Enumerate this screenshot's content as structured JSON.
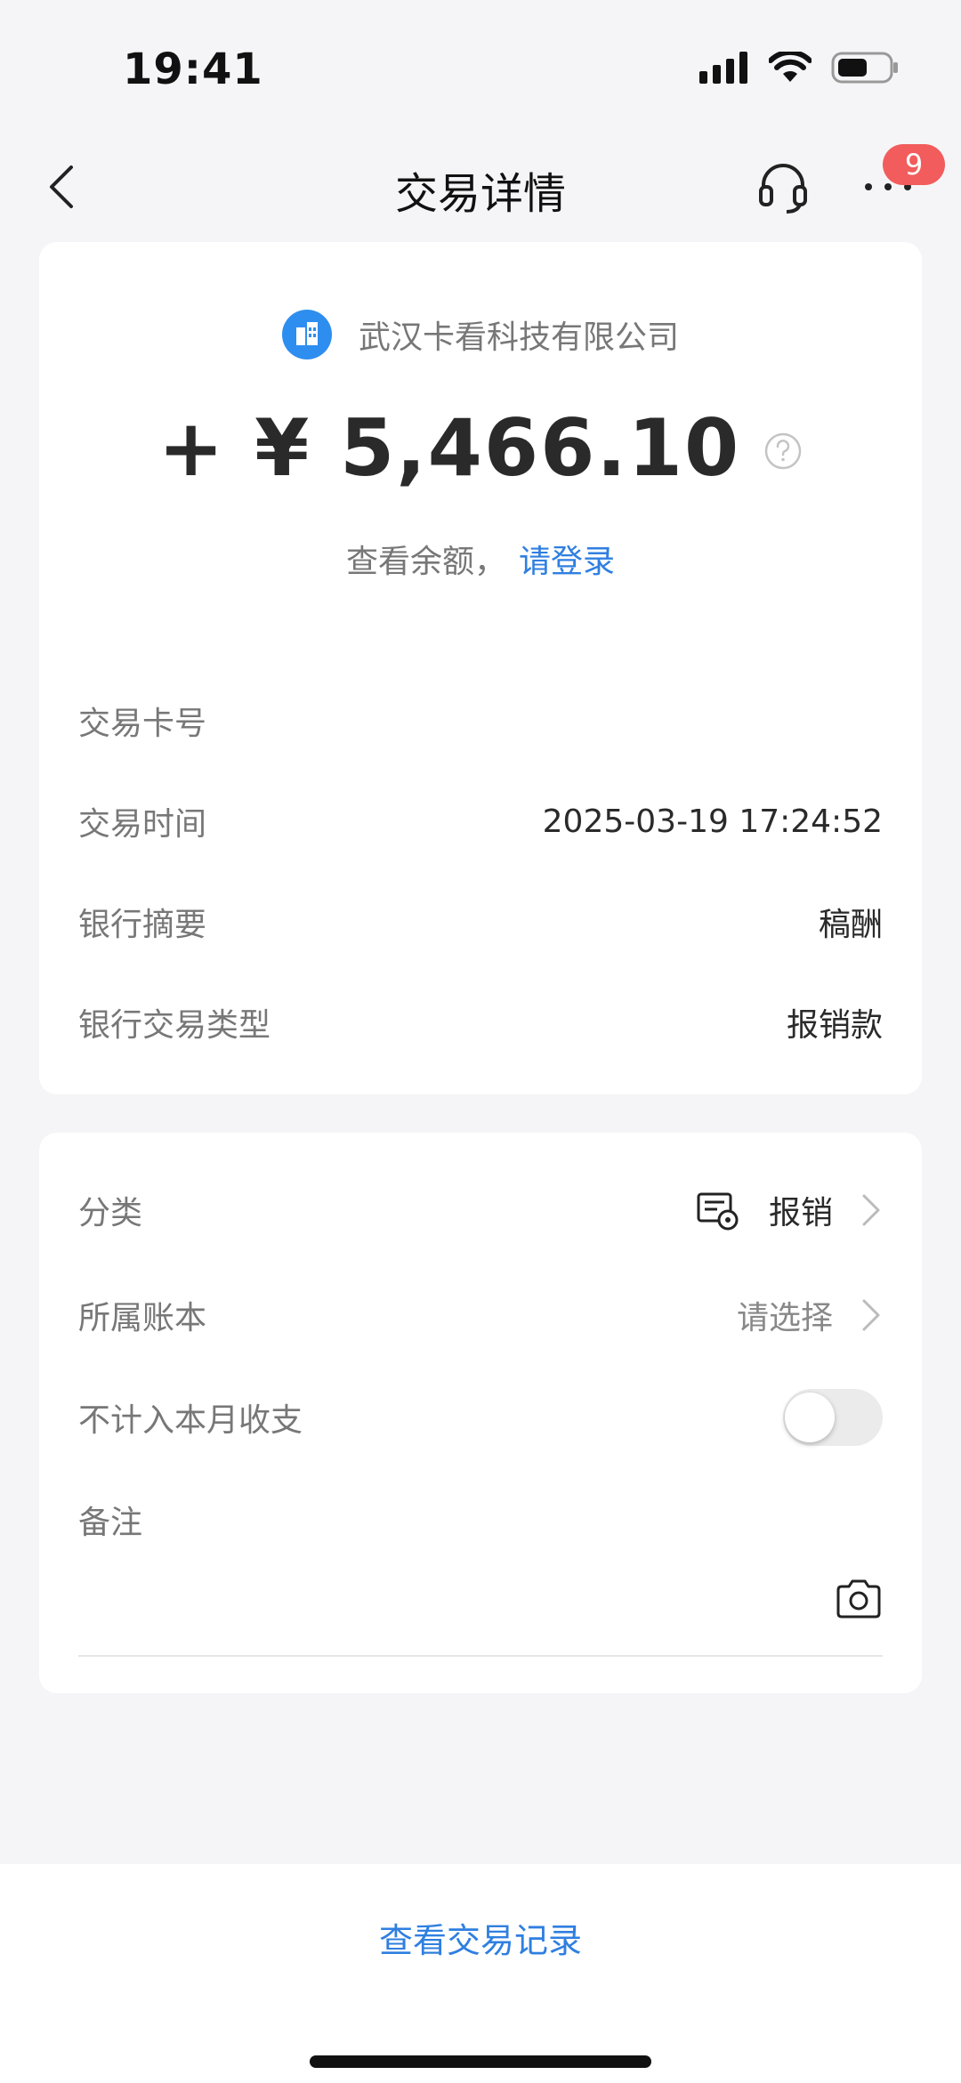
{
  "status_bar": {
    "time": "19:41"
  },
  "nav": {
    "title": "交易详情",
    "badge_count": "9"
  },
  "transaction": {
    "merchant_name": "武汉卡看科技有限公司",
    "amount": "+ ¥ 5,466.10",
    "balance_label": "查看余额，",
    "login_link": "请登录"
  },
  "details": [
    {
      "label": "交易卡号",
      "value": ""
    },
    {
      "label": "交易时间",
      "value": "2025-03-19 17:24:52"
    },
    {
      "label": "银行摘要",
      "value": "稿酬"
    },
    {
      "label": "银行交易类型",
      "value": "报销款"
    }
  ],
  "form": {
    "category_label": "分类",
    "category_value": "报销",
    "ledger_label": "所属账本",
    "ledger_value": "请选择",
    "exclude_label": "不计入本月收支",
    "exclude_enabled": false,
    "note_label": "备注"
  },
  "footer": {
    "record_link": "查看交易记录"
  },
  "colors": {
    "accent": "#2f7fe0",
    "badge": "#f25c5c",
    "merchant_logo": "#2e8ef0"
  }
}
